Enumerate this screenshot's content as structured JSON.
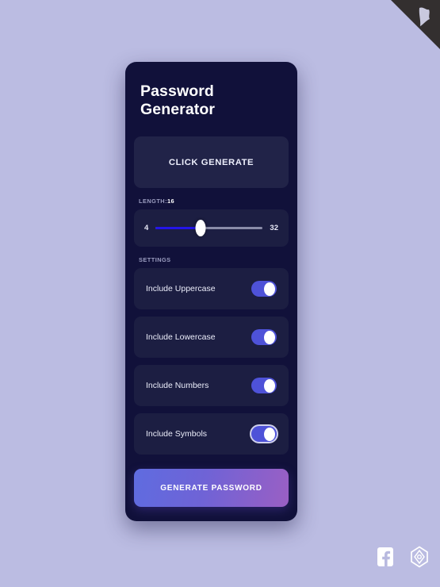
{
  "page": {
    "background_color": "#bbbce2"
  },
  "corner_ribbon": {
    "icon": "flag-glyph-icon",
    "color": "#332f2f"
  },
  "card": {
    "title": "Password Generator",
    "background_color": "#11113a"
  },
  "output": {
    "text": "CLICK GENERATE"
  },
  "length": {
    "label_prefix": "LENGTH:",
    "value": "16",
    "min_label": "4",
    "max_label": "32",
    "min": 4,
    "max": 32,
    "percent": 42,
    "fill_color": "#2414e8"
  },
  "settings": {
    "label": "SETTINGS",
    "options": [
      {
        "label": "Include Uppercase",
        "on": true,
        "focused": false
      },
      {
        "label": "Include Lowercase",
        "on": true,
        "focused": false
      },
      {
        "label": "Include Numbers",
        "on": true,
        "focused": false
      },
      {
        "label": "Include Symbols",
        "on": true,
        "focused": true
      }
    ],
    "toggle_on_color": "#4e52d8"
  },
  "actions": {
    "generate_label": "GENERATE PASSWORD"
  },
  "footer": {
    "icons": [
      "facebook-icon",
      "gem-logo-icon"
    ]
  }
}
